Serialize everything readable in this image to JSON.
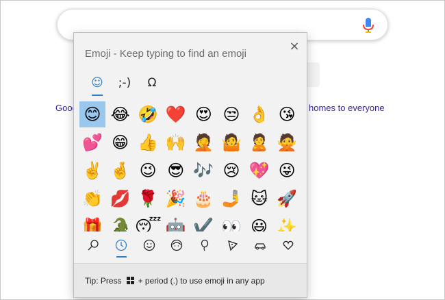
{
  "background": {
    "link_left": "Goog",
    "link_right": "homes to everyone"
  },
  "panel": {
    "title": "Emoji - Keep typing to find an emoji",
    "close_glyph": "×",
    "top_tabs": [
      {
        "name": "emoji",
        "glyph": "☺",
        "active": true
      },
      {
        "name": "kaomoji",
        "glyph": ";-)",
        "active": false
      },
      {
        "name": "symbols",
        "glyph": "Ω",
        "active": false
      }
    ],
    "emojis": [
      "😊",
      "😂",
      "🤣",
      "❤️",
      "😍",
      "😒",
      "👌",
      "😘",
      "💕",
      "😁",
      "👍",
      "🙌",
      "🤦",
      "🤷",
      "🙎",
      "🙅",
      "✌️",
      "🤞",
      "😉",
      "😎",
      "🎶",
      "😢",
      "💖",
      "😜",
      "👏",
      "💋",
      "🌹",
      "🎉",
      "🎂",
      "🤳",
      "🐱",
      "🚀",
      "🎁",
      "🐊",
      "😴",
      "🤖",
      "✔️",
      "👀",
      "😃",
      "✨"
    ],
    "bottom_tabs": [
      {
        "name": "search-icon",
        "active": false
      },
      {
        "name": "recent-clock-icon",
        "active": true
      },
      {
        "name": "smiley-face-icon",
        "active": false
      },
      {
        "name": "people-icon",
        "active": false
      },
      {
        "name": "balloon-icon",
        "active": false
      },
      {
        "name": "pizza-icon",
        "active": false
      },
      {
        "name": "car-icon",
        "active": false
      },
      {
        "name": "heart-icon",
        "active": false
      }
    ],
    "tip_prefix": "Tip: Press",
    "tip_suffix": "+ period (.) to use emoji in any app"
  },
  "colors": {
    "accent": "#2f7fc8",
    "selected_cell": "#99c7ee",
    "panel_bg": "#f2f2f2"
  }
}
